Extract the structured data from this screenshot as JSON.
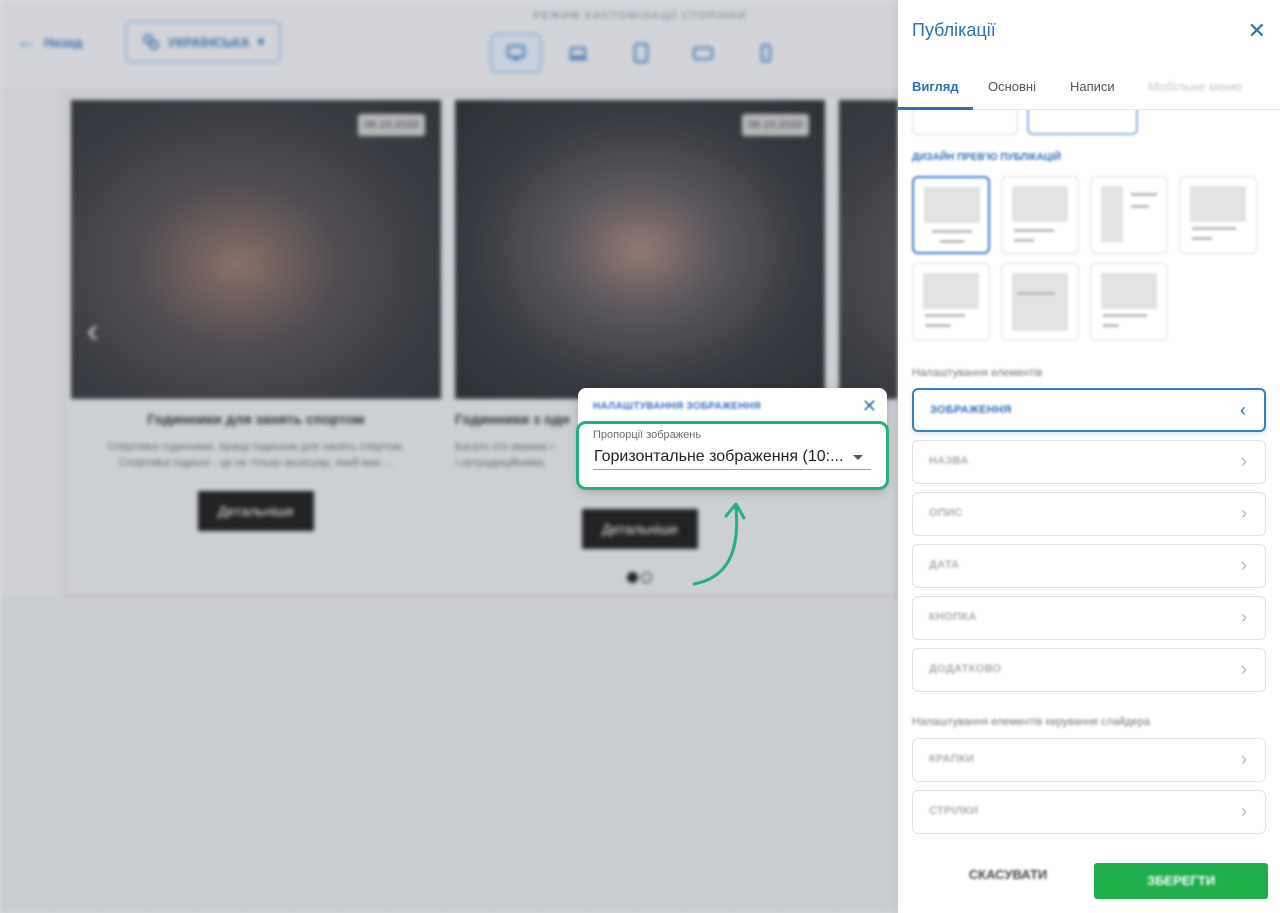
{
  "topbar": {
    "back_label": "Назад",
    "language_label": "УКРАЇНСЬКА",
    "mode_title": "РЕЖИМ КАСТОМІЗАЦІЇ СТОРІНКИ",
    "devices": [
      "desktop",
      "laptop",
      "tablet",
      "tablet-landscape",
      "mobile"
    ]
  },
  "preview": {
    "cards": [
      {
        "date": "06.10.2020",
        "title": "Годинники для занять спортом",
        "description_line1": "Спортивні годинники. Кращі годинник для занять спортом.",
        "description_line2": "Спортивні годинні - це не тільки аксесуар, який має ...",
        "button": "Детальніше"
      },
      {
        "date": "06.10.2020",
        "title": "Годинники з одн",
        "description_line1": "Багато хто вважає г",
        "description_line2": "і нетрадиційними,",
        "button": "Детальніше"
      }
    ],
    "active_slide": 1,
    "total_slides": 2
  },
  "image_popup": {
    "title": "НАЛАШТУВАННЯ ЗОБРАЖЕННЯ",
    "field_label": "Пропорції зображень",
    "selected_value": "Горизонтальне зображення (10:..."
  },
  "panel": {
    "title": "Публікації",
    "tabs": [
      {
        "label": "Вигляд",
        "active": true
      },
      {
        "label": "Основні",
        "active": false
      },
      {
        "label": "Написи",
        "active": false
      },
      {
        "label": "Мобільне меню",
        "active": false
      }
    ],
    "design_label": "ДИЗАЙН ПРЕВ'Ю ПУБЛІКАЦІЙ",
    "elements_label": "Налаштування елементів",
    "elements": [
      {
        "label": "ЗОБРАЖЕННЯ",
        "open": true
      },
      {
        "label": "НАЗВА",
        "open": false
      },
      {
        "label": "ОПИС",
        "open": false
      },
      {
        "label": "ДАТА",
        "open": false
      },
      {
        "label": "КНОПКА",
        "open": false
      },
      {
        "label": "ДОДАТКОВО",
        "open": false
      }
    ],
    "slider_label": "Налаштування елементів керування слайдера",
    "slider_elements": [
      {
        "label": "КРАПКИ"
      },
      {
        "label": "СТРІЛКИ"
      }
    ],
    "cancel_label": "СКАСУВАТИ",
    "save_label": "ЗБЕРЕГТИ"
  },
  "colors": {
    "accent_blue": "#2f6fb7",
    "highlight_green": "#22b07d",
    "save_green": "#1fae4b"
  }
}
